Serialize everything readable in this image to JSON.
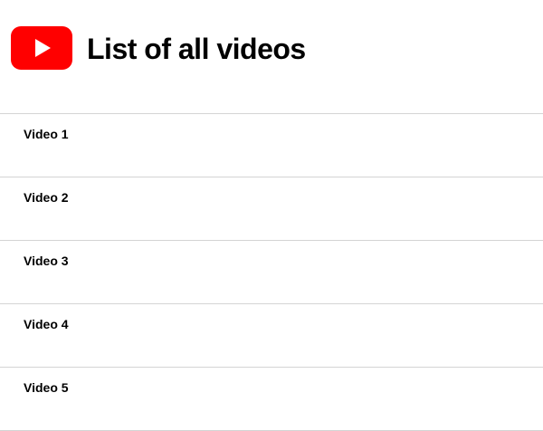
{
  "header": {
    "logo_icon": "youtube-logo-icon",
    "brand_color": "#ff0000",
    "title": "List of all videos"
  },
  "videos": [
    {
      "label": "Video 1"
    },
    {
      "label": "Video 2"
    },
    {
      "label": "Video 3"
    },
    {
      "label": "Video 4"
    },
    {
      "label": "Video 5"
    }
  ],
  "colors": {
    "divider": "#d4d4d4",
    "text": "#000000",
    "background": "#ffffff"
  }
}
